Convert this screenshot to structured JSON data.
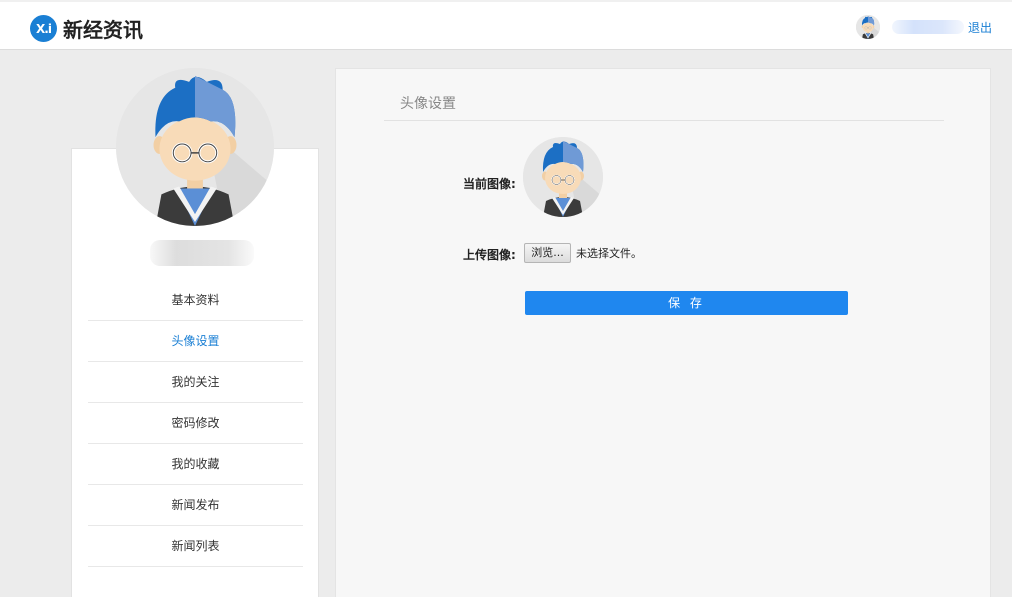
{
  "header": {
    "logo_mark": "X.i",
    "site_name": "新经资讯",
    "logout_label": "退出"
  },
  "sidebar": {
    "items": [
      {
        "label": "基本资料"
      },
      {
        "label": "头像设置"
      },
      {
        "label": "我的关注"
      },
      {
        "label": "密码修改"
      },
      {
        "label": "我的收藏"
      },
      {
        "label": "新闻发布"
      },
      {
        "label": "新闻列表"
      }
    ],
    "active_item": "头像设置"
  },
  "main": {
    "title": "头像设置",
    "current_avatar_label": "当前图像:",
    "upload_label": "上传图像:",
    "browse_label": "浏览...",
    "no_file_text": "未选择文件。",
    "save_label": "保 存"
  },
  "colors": {
    "accent": "#1a7fd4",
    "save_button": "#1f87ef",
    "avatar_hair": "#1c6fc4"
  },
  "icons": [
    "logo-icon",
    "user-avatar-icon"
  ]
}
